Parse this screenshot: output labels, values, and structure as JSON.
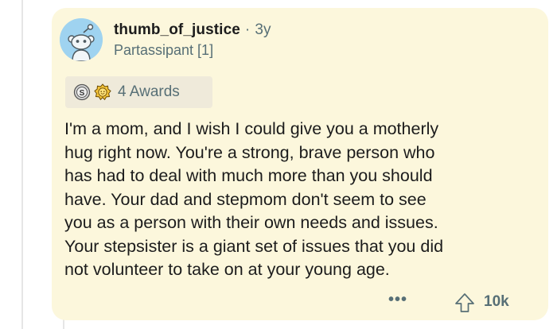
{
  "comment": {
    "username": "thumb_of_justice",
    "separator": "·",
    "age": "3y",
    "flair": "Partassipant [1]",
    "awards": {
      "count_label": "4 Awards",
      "icons": [
        "silver-award-icon",
        "wholesome-award-icon"
      ]
    },
    "body_lines": [
      "I'm a mom, and I wish I could give you a motherly",
      "hug right now. You're a strong, brave person who",
      "has had to deal with much more than you should",
      "have. Your dad and stepmom don't seem to see",
      "you as a person with their own needs and issues.",
      "Your stepsister is a giant set of issues that you did",
      "not volunteer to take on at your young age."
    ],
    "more_label": "•••",
    "score": "10k",
    "colors": {
      "card_bg": "#fcf7dc",
      "avatar_bg": "#9fd3f0",
      "muted_text": "#576f76"
    }
  }
}
